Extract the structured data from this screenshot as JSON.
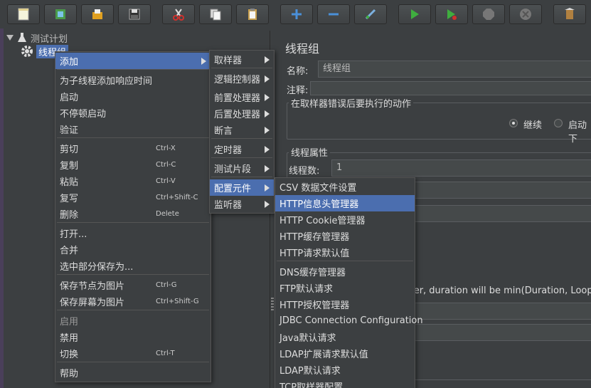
{
  "tree": {
    "root_label": "测试计划",
    "child_label": "线程组"
  },
  "right_panel": {
    "title": "线程组",
    "name_label": "名称:",
    "name_value": "线程组",
    "comment_label": "注释:",
    "error_group_title": "在取样器错误后要执行的动作",
    "error_options": [
      "继续",
      "启动下"
    ],
    "thread_props_title": "线程属性",
    "thread_count_label": "线程数:",
    "thread_count_value": "1",
    "duration_text": "ever, duration will be min(Duration, Loop Co"
  },
  "context_menu": {
    "items": [
      {
        "label": "添加",
        "accel": "",
        "submenu": true
      },
      {
        "label": "为子线程添加响应时间",
        "accel": ""
      },
      {
        "label": "启动",
        "accel": ""
      },
      {
        "label": "不停顿启动",
        "accel": ""
      },
      {
        "label": "验证",
        "accel": ""
      },
      {
        "label": "剪切",
        "accel": "Ctrl-X"
      },
      {
        "label": "复制",
        "accel": "Ctrl-C"
      },
      {
        "label": "粘贴",
        "accel": "Ctrl-V"
      },
      {
        "label": "复写",
        "accel": "Ctrl+Shift-C"
      },
      {
        "label": "删除",
        "accel": "Delete"
      },
      {
        "label": "打开...",
        "accel": ""
      },
      {
        "label": "合并",
        "accel": ""
      },
      {
        "label": "选中部分保存为...",
        "accel": ""
      },
      {
        "label": "保存节点为图片",
        "accel": "Ctrl-G"
      },
      {
        "label": "保存屏幕为图片",
        "accel": "Ctrl+Shift-G"
      },
      {
        "label": "启用",
        "accel": ""
      },
      {
        "label": "禁用",
        "accel": ""
      },
      {
        "label": "切换",
        "accel": "Ctrl-T"
      },
      {
        "label": "帮助",
        "accel": ""
      }
    ]
  },
  "add_submenu": {
    "items": [
      "取样器",
      "逻辑控制器",
      "前置处理器",
      "后置处理器",
      "断言",
      "定时器",
      "测试片段",
      "配置元件",
      "监听器"
    ]
  },
  "config_submenu": {
    "items": [
      "CSV 数据文件设置",
      "HTTP信息头管理器",
      "HTTP Cookie管理器",
      "HTTP缓存管理器",
      "HTTP请求默认值",
      "DNS缓存管理器",
      "FTP默认请求",
      "HTTP授权管理器",
      "JDBC Connection Configuration",
      "Java默认请求",
      "LDAP扩展请求默认值",
      "LDAP默认请求",
      "TCP取样器配置"
    ]
  },
  "colors": {
    "background": "#3c3f41",
    "selection": "#4b6eaf",
    "green_run": "#3fae3f",
    "red_cut": "#d0312d",
    "blue_add": "#4a90d9"
  },
  "toolbar_icons": [
    "new-icon",
    "templates-icon",
    "open-icon",
    "save-icon",
    "cut-icon",
    "copy-icon",
    "paste-icon",
    "expand-icon",
    "collapse-icon",
    "toggle-icon",
    "start-icon",
    "start-no-pause-icon",
    "stop-icon",
    "shutdown-icon",
    "clear-icon"
  ]
}
